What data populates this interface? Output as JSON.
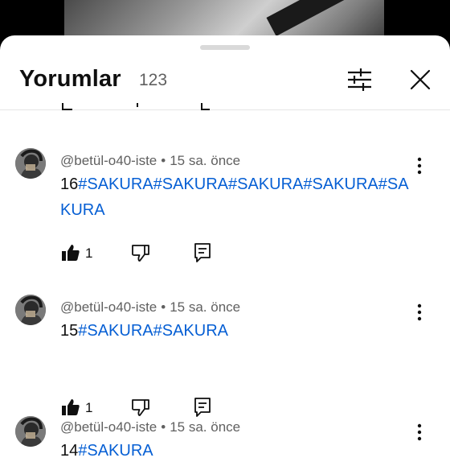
{
  "panel": {
    "title": "Yorumlar",
    "count": "123"
  },
  "colors": {
    "link": "#065fd4",
    "text": "#0f0f0f",
    "secondary": "#606060"
  },
  "icons": {
    "filter": "sliders-icon",
    "close": "close-icon",
    "more": "more-vert-icon",
    "like": "thumbs-up-filled-icon",
    "dislike": "thumbs-down-icon",
    "reply": "reply-icon"
  },
  "comments": [
    {
      "author": "@betül-o40-iste",
      "separator": "•",
      "time": "15 sa. önce",
      "number": "16",
      "tags": "#SAKURA#SAKURA#SAKURA#SAKURA#SAKURA",
      "likes": "1"
    },
    {
      "author": "@betül-o40-iste",
      "separator": "•",
      "time": "15 sa. önce",
      "number": "15",
      "tags": "#SAKURA#SAKURA",
      "likes": "1"
    },
    {
      "author": "@betül-o40-iste",
      "separator": "•",
      "time": "15 sa. önce",
      "number": "14",
      "tags": "#SAKURA",
      "likes": ""
    }
  ]
}
